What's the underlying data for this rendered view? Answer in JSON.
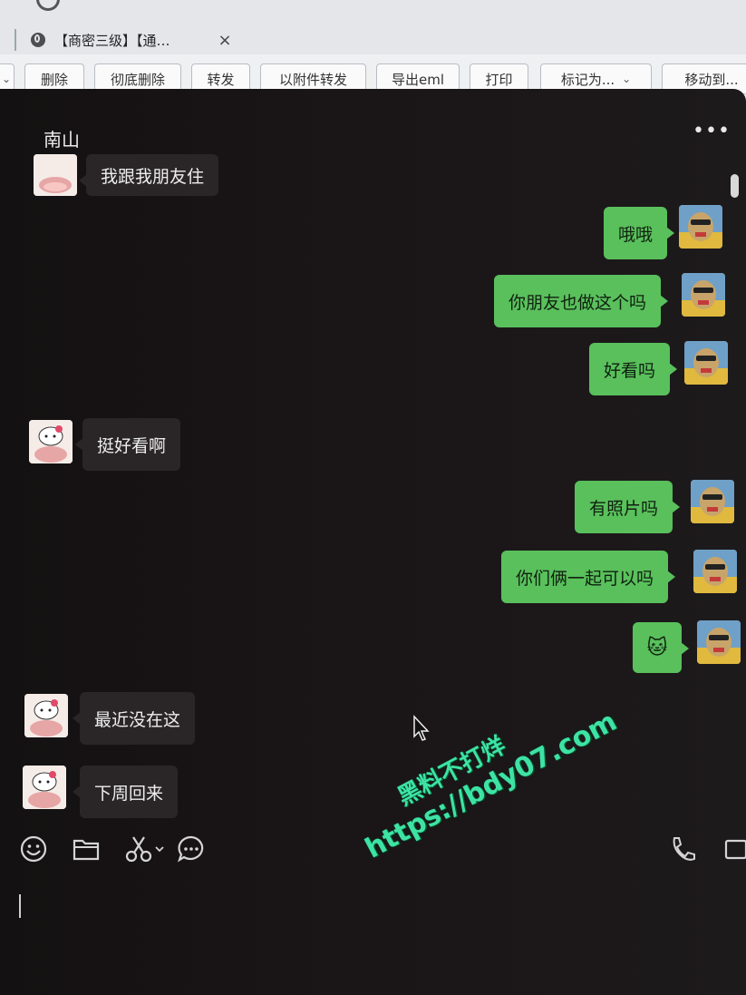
{
  "browser": {
    "tab_title": "【商密三级】【通…",
    "tab_close": "×"
  },
  "toolbar": {
    "buttons": [
      "删除",
      "彻底删除",
      "转发",
      "以附件转发",
      "导出eml",
      "打印"
    ],
    "mark_as": "标记为...",
    "move_to": "移动到..."
  },
  "chat": {
    "contact_name": "南山",
    "more": "•••",
    "messages": [
      {
        "side": "in",
        "text": "我跟我朋友住"
      },
      {
        "side": "out",
        "text": "哦哦"
      },
      {
        "side": "out",
        "text": "你朋友也做这个吗"
      },
      {
        "side": "out",
        "text": "好看吗"
      },
      {
        "side": "in",
        "text": "挺好看啊"
      },
      {
        "side": "out",
        "text": "有照片吗"
      },
      {
        "side": "out",
        "text": "你们俩一起可以吗"
      },
      {
        "side": "out",
        "text": "🐱"
      },
      {
        "side": "in",
        "text": "最近没在这"
      },
      {
        "side": "in",
        "text": "下周回来"
      }
    ]
  },
  "input_tools": [
    "emoji-icon",
    "folder-icon",
    "scissors-icon",
    "chat-bubble-icon",
    "phone-icon",
    "video-icon"
  ],
  "watermark": {
    "line1": "黑料不打烊",
    "line2": "https://bdy07.com"
  },
  "colors": {
    "outgoing_bubble": "#59c05c",
    "incoming_bubble": "#2a2627",
    "chat_background": "#161213",
    "watermark": "#3ee3a4"
  }
}
